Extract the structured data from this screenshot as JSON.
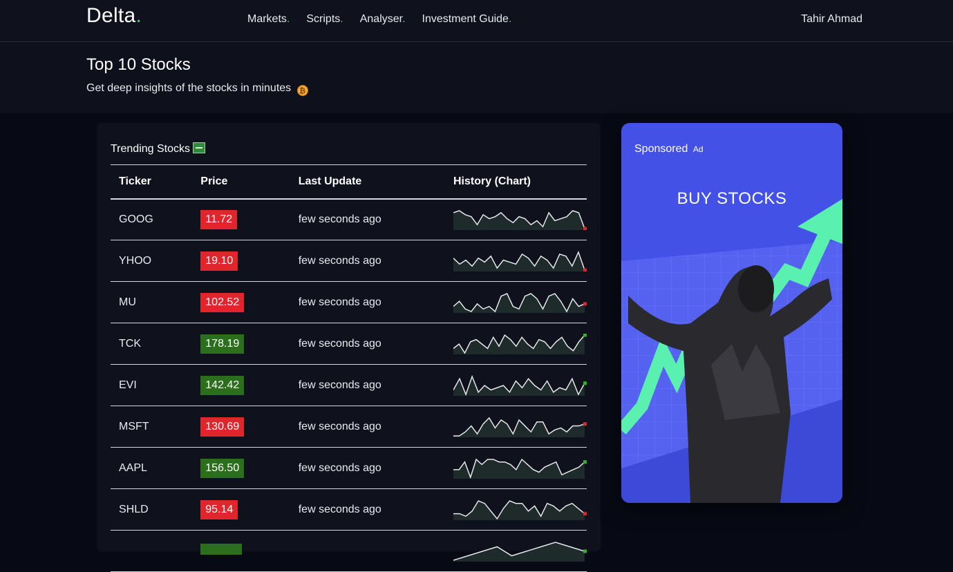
{
  "header": {
    "logo": "Delta",
    "logo_dot": ".",
    "nav": [
      {
        "label": "Markets",
        "dot": "."
      },
      {
        "label": "Scripts",
        "dot": "."
      },
      {
        "label": "Analyser",
        "dot": "."
      },
      {
        "label": "Investment Guide",
        "dot": "."
      }
    ],
    "user": "Tahir Ahmad"
  },
  "hero": {
    "title": "Top 10 Stocks",
    "subtitle": "Get deep insights of the stocks in minutes"
  },
  "trending": {
    "title": "Trending Stocks",
    "columns": [
      "Ticker",
      "Price",
      "Last Update",
      "History (Chart)"
    ],
    "rows": [
      {
        "ticker": "GOOG",
        "price": "11.72",
        "trend": "down",
        "updated": "few seconds ago",
        "history": [
          8,
          9,
          7,
          6,
          2,
          7,
          5,
          6,
          8,
          5,
          3,
          6,
          5,
          2,
          4,
          1,
          8,
          4,
          5,
          6,
          9,
          8,
          0
        ]
      },
      {
        "ticker": "YHOO",
        "price": "19.10",
        "trend": "down",
        "updated": "few seconds ago",
        "history": [
          6,
          3,
          5,
          2,
          6,
          4,
          7,
          1,
          5,
          4,
          3,
          8,
          6,
          2,
          7,
          5,
          1,
          8,
          7,
          2,
          9,
          0
        ]
      },
      {
        "ticker": "MU",
        "price": "102.52",
        "trend": "down",
        "updated": "few seconds ago",
        "history": [
          4,
          6,
          3,
          2,
          5,
          3,
          4,
          2,
          8,
          9,
          4,
          3,
          8,
          9,
          7,
          3,
          8,
          9,
          6,
          2,
          7,
          4,
          5
        ]
      },
      {
        "ticker": "TCK",
        "price": "178.19",
        "trend": "up",
        "updated": "few seconds ago",
        "history": [
          3,
          5,
          1,
          6,
          7,
          5,
          3,
          8,
          4,
          9,
          7,
          4,
          8,
          5,
          3,
          7,
          6,
          3,
          6,
          8,
          4,
          2,
          6,
          9
        ]
      },
      {
        "ticker": "EVI",
        "price": "142.42",
        "trend": "up",
        "updated": "few seconds ago",
        "history": [
          4,
          9,
          2,
          10,
          3,
          6,
          4,
          5,
          6,
          3,
          8,
          5,
          9,
          6,
          4,
          8,
          3,
          5,
          4,
          9,
          2,
          7
        ]
      },
      {
        "ticker": "MSFT",
        "price": "130.69",
        "trend": "down",
        "updated": "few seconds ago",
        "history": [
          1,
          1,
          3,
          6,
          2,
          7,
          10,
          5,
          9,
          7,
          2,
          9,
          6,
          3,
          8,
          8,
          2,
          4,
          5,
          3,
          6,
          6,
          7
        ]
      },
      {
        "ticker": "AAPL",
        "price": "156.50",
        "trend": "up",
        "updated": "few seconds ago",
        "history": [
          4,
          4,
          7,
          1,
          8,
          6,
          8,
          8,
          7,
          7,
          6,
          4,
          8,
          6,
          4,
          3,
          5,
          6,
          7,
          2,
          3,
          4,
          5,
          7
        ]
      },
      {
        "ticker": "SHLD",
        "price": "95.14",
        "trend": "down",
        "updated": "few seconds ago",
        "history": [
          3,
          3,
          2,
          4,
          8,
          7,
          4,
          1,
          5,
          8,
          7,
          7,
          4,
          6,
          2,
          7,
          6,
          4,
          6,
          7,
          5,
          3
        ]
      },
      {
        "ticker": "",
        "price": "",
        "trend": "up",
        "updated": "",
        "history": [
          3,
          4,
          5,
          6,
          4,
          5,
          6,
          7,
          6,
          5
        ]
      }
    ]
  },
  "ad": {
    "sponsored": "Sponsored",
    "tag": "Ad",
    "headline": "BUY STOCKS"
  },
  "colors": {
    "up": "#2b6f1d",
    "down": "#e0262c",
    "accent_dot": "#3fd16a",
    "ad_bg": "#4451e6"
  }
}
